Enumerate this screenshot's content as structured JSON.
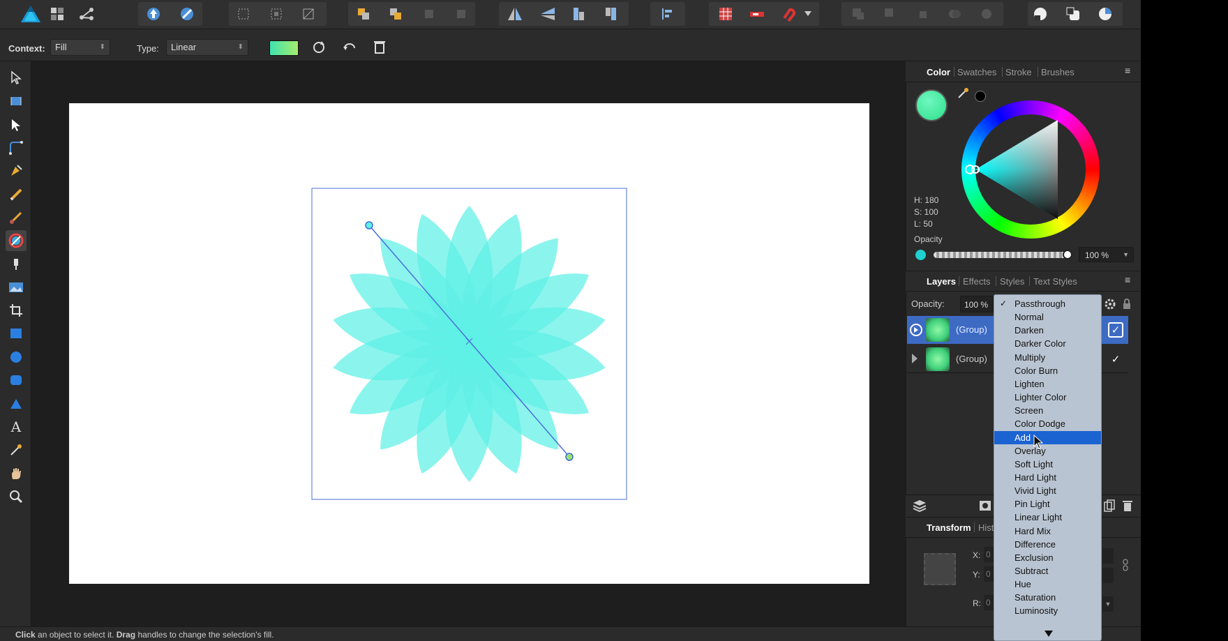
{
  "context_bar": {
    "context_label": "Context:",
    "context_value": "Fill",
    "type_label": "Type:",
    "type_value": "Linear"
  },
  "color_panel": {
    "tabs": [
      "Color",
      "Swatches",
      "Stroke",
      "Brushes"
    ],
    "h": "H: 180",
    "s": "S: 100",
    "l": "L: 50",
    "opacity_label": "Opacity",
    "opacity_value": "100 %",
    "current_color": "#4ef0a8"
  },
  "layers_panel": {
    "tabs": [
      "Layers",
      "Effects",
      "Styles",
      "Text Styles"
    ],
    "opacity_label": "Opacity:",
    "opacity_value": "100 %",
    "layers": [
      {
        "name": "(Group)",
        "selected": true,
        "visible": true
      },
      {
        "name": "(Group)",
        "selected": false,
        "visible": true
      }
    ]
  },
  "transform_panel": {
    "tabs": [
      "Transform",
      "Hist"
    ],
    "x_label": "X:",
    "y_label": "Y:",
    "r_label": "R:",
    "x_value": "0",
    "y_value": "0",
    "r_value": "0"
  },
  "blend_menu": {
    "checked": "Passthrough",
    "highlighted": "Add",
    "items": [
      "Passthrough",
      "Normal",
      "Darken",
      "Darker Color",
      "Multiply",
      "Color Burn",
      "Lighten",
      "Lighter Color",
      "Screen",
      "Color Dodge",
      "Add",
      "Overlay",
      "Soft Light",
      "Hard Light",
      "Vivid Light",
      "Pin Light",
      "Linear Light",
      "Hard Mix",
      "Difference",
      "Exclusion",
      "Subtract",
      "Hue",
      "Saturation",
      "Luminosity"
    ]
  },
  "status": {
    "click_word": "Click",
    "click_text": " an object to select it.",
    "drag_word": "Drag",
    "drag_text": " handles to change the selection's fill."
  },
  "colors": {
    "accent": "#1b63d1",
    "selection": "#4a6fd8",
    "gradient_start": "#5ef0e6",
    "gradient_end": "#c6f98a"
  }
}
